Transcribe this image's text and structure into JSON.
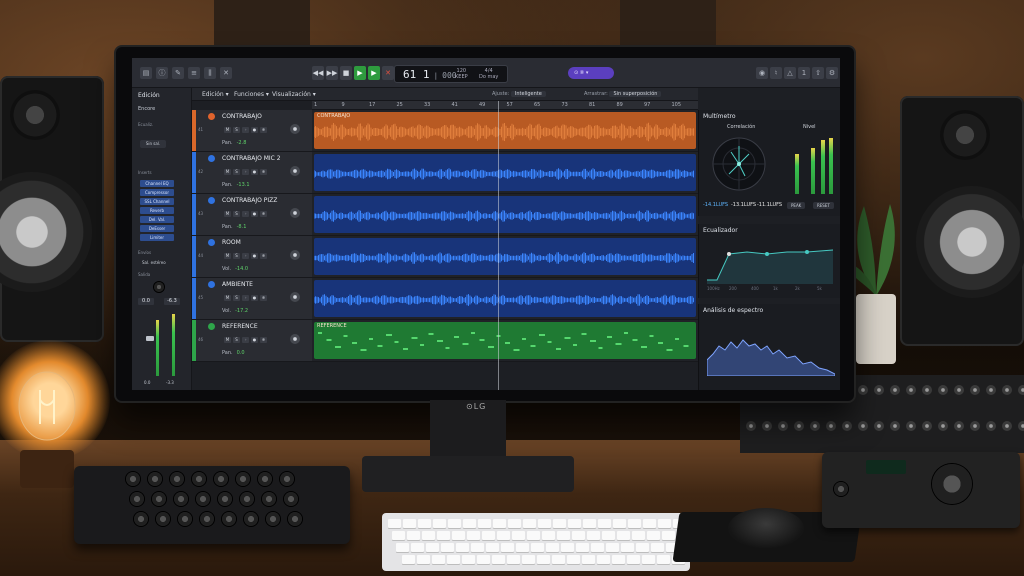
{
  "app": {
    "toolbar_icons": [
      "library-icon",
      "inspector-icon",
      "notes-icon",
      "list-icon",
      "mixer-icon",
      "close-icon"
    ],
    "transport": {
      "position": "61 1",
      "position_suffix": "000",
      "tempo": "120",
      "tempo_label": "KEEP",
      "signature": "4/4",
      "key": "Do may"
    },
    "mode_pill": "⊙ ⑧ ▾",
    "right_icons": [
      "mic-icon",
      "tuner-icon",
      "metronome-icon",
      "count-in-icon",
      "share-icon",
      "settings-icon"
    ]
  },
  "inspector": {
    "title": "Edición",
    "region_name": "Encore",
    "label_region": "Ecualiz.",
    "field_value": "Sin sal.",
    "label_inserts": "Inserts",
    "plugins": [
      "Channel EQ",
      "Compressor",
      "SSL Channel",
      "Reverb",
      "Del. Val.",
      "DeEsser",
      "Limiter"
    ],
    "label_sends": "Envíos",
    "send_value": "Sal. estéreo",
    "label_output": "Salida",
    "val_left": "0.0",
    "val_right": "-6.3",
    "foot_left": "0.0",
    "foot_right": "-3.3"
  },
  "menubar": {
    "items": [
      "Edición ▾",
      "Funciones ▾",
      "Visualización ▾"
    ],
    "snap_label": "Ajuste:",
    "snap_value": "Inteligente",
    "drag_label": "Arrastrar:",
    "drag_value": "Sin superposición"
  },
  "ruler": {
    "ticks": [
      "1",
      "9",
      "17",
      "25",
      "33",
      "41",
      "49",
      "57",
      "65",
      "73",
      "81",
      "89",
      "97",
      "105"
    ]
  },
  "tracks": [
    {
      "num": "41",
      "name": "CONTRABAJO",
      "param_label": "Pan.",
      "param_value": "-2.8",
      "color": "#d9682a",
      "region_name": "CONTRABAJO",
      "region_color": "#b85a23",
      "wave_color": "#e07e3c"
    },
    {
      "num": "42",
      "name": "CONTRABAJO MIC 2",
      "param_label": "Pan.",
      "param_value": "-13.1",
      "color": "#2f72e0",
      "region_name": "",
      "region_color": "#18347a",
      "wave_color": "#3b86ff"
    },
    {
      "num": "43",
      "name": "CONTRABAJO PIZZ",
      "param_label": "Pan.",
      "param_value": "-8.1",
      "color": "#2f72e0",
      "region_name": "",
      "region_color": "#18347a",
      "wave_color": "#3b86ff"
    },
    {
      "num": "44",
      "name": "ROOM",
      "param_label": "Vol.",
      "param_value": "-14.0",
      "color": "#2f72e0",
      "region_name": "",
      "region_color": "#18347a",
      "wave_color": "#3b86ff"
    },
    {
      "num": "45",
      "name": "AMBIENTE",
      "param_label": "Vol.",
      "param_value": "-17.2",
      "color": "#2f72e0",
      "region_name": "",
      "region_color": "#18347a",
      "wave_color": "#3b86ff"
    },
    {
      "num": "46",
      "name": "REFERENCE",
      "param_label": "Pan.",
      "param_value": "0.0",
      "color": "#2ea54a",
      "region_name": "REFERENCE",
      "region_color": "#1f7a33",
      "wave_color": "#55d86e"
    }
  ],
  "multimeter": {
    "title": "Multímetro",
    "tab_correlation": "Correlación",
    "tab_level": "Nivel",
    "read_1": "-14.1LUFS",
    "read_2": "-13.1LUFS",
    "read_3": "-11.1LUFS",
    "btn_left": "PEAK",
    "btn_right": "RESET"
  },
  "equalizer": {
    "title": "Ecualizador",
    "axis": [
      "100Hz",
      "200",
      "400",
      "1k",
      "2k",
      "5k"
    ]
  },
  "spectrum": {
    "title": "Análisis de espectro"
  },
  "monitor": {
    "brand": "⊙LG"
  }
}
